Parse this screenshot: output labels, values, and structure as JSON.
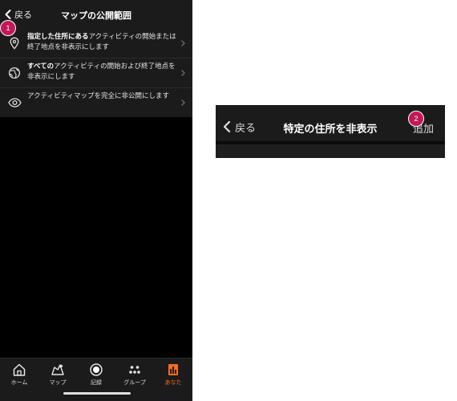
{
  "screen1": {
    "back_label": "戻る",
    "title": "マップの公開範囲",
    "options": [
      {
        "bold": "指定した住所にある",
        "text": "アクティビティの開始または終了地点を非表示にします",
        "icon": "location-pin-icon"
      },
      {
        "bold": "すべての",
        "text": "アクティビティの開始および終了地点を非表示にします",
        "icon": "globe-icon"
      },
      {
        "bold": "",
        "text": "アクティビティマップを完全に非公開にします",
        "icon": "eye-icon"
      }
    ],
    "tabs": [
      {
        "label": "ホーム",
        "icon": "home-icon"
      },
      {
        "label": "マップ",
        "icon": "map-icon"
      },
      {
        "label": "記録",
        "icon": "record-icon"
      },
      {
        "label": "グループ",
        "icon": "group-icon"
      },
      {
        "label": "あなた",
        "icon": "you-icon",
        "active": true
      }
    ]
  },
  "screen2": {
    "back_label": "戻る",
    "title": "特定の住所を非表示",
    "add_label": "追加"
  },
  "callouts": {
    "first": "1",
    "second": "2"
  },
  "colors": {
    "accent": "#ff6b1a",
    "badge": "#c2185b",
    "background": "#000000",
    "surface": "#1b1b1b"
  }
}
